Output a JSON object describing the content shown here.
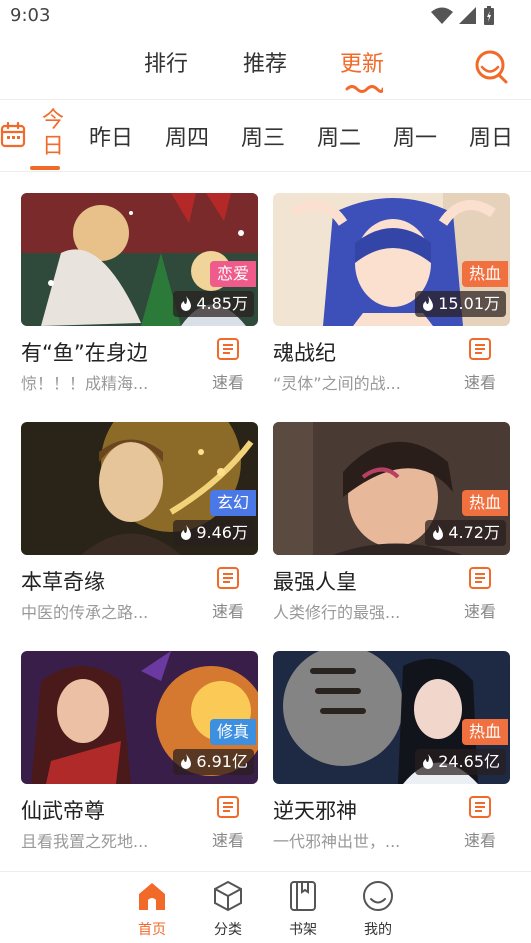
{
  "status_bar": {
    "time": "9:03"
  },
  "top_tabs": [
    {
      "label": "排行",
      "active": false
    },
    {
      "label": "推荐",
      "active": false
    },
    {
      "label": "更新",
      "active": true
    }
  ],
  "day_tabs": [
    "今日",
    "昨日",
    "周四",
    "周三",
    "周二",
    "周一",
    "周日"
  ],
  "quick_read_label": "速看",
  "comics": [
    {
      "title": "有“鱼”在身边",
      "desc": "惊！！！成精海...",
      "genre": "恋爱",
      "genre_color": "#ef5b8a",
      "heat": "4.85万"
    },
    {
      "title": "魂战纪",
      "desc": "“灵体”之间的战...",
      "genre": "热血",
      "genre_color": "#f07040",
      "heat": "15.01万"
    },
    {
      "title": "本草奇缘",
      "desc": "中医的传承之路...",
      "genre": "玄幻",
      "genre_color": "#4a78e6",
      "heat": "9.46万"
    },
    {
      "title": "最强人皇",
      "desc": "人类修行的最强...",
      "genre": "热血",
      "genre_color": "#f07040",
      "heat": "4.72万"
    },
    {
      "title": "仙武帝尊",
      "desc": "且看我置之死地...",
      "genre": "修真",
      "genre_color": "#3d8fe0",
      "heat": "6.91亿"
    },
    {
      "title": "逆天邪神",
      "desc": "一代邪神出世，...",
      "genre": "热血",
      "genre_color": "#f07040",
      "heat": "24.65亿"
    }
  ],
  "bottom_nav": [
    {
      "label": "首页",
      "icon": "home-icon",
      "active": true
    },
    {
      "label": "分类",
      "icon": "cube-icon",
      "active": false
    },
    {
      "label": "书架",
      "icon": "book-icon",
      "active": false
    },
    {
      "label": "我的",
      "icon": "smile-icon",
      "active": false
    }
  ],
  "colors": {
    "accent": "#f26a2a"
  }
}
